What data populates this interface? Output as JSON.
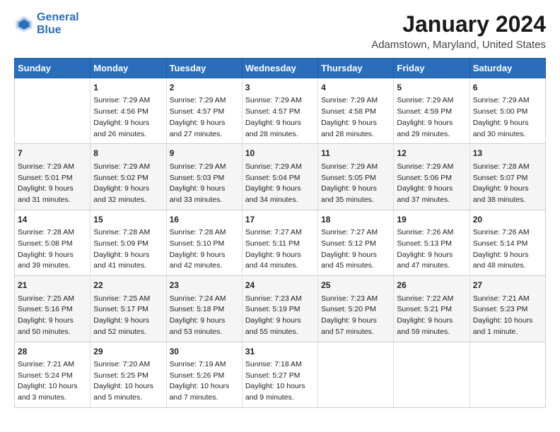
{
  "header": {
    "logo_line1": "General",
    "logo_line2": "Blue",
    "month": "January 2024",
    "location": "Adamstown, Maryland, United States"
  },
  "days_of_week": [
    "Sunday",
    "Monday",
    "Tuesday",
    "Wednesday",
    "Thursday",
    "Friday",
    "Saturday"
  ],
  "weeks": [
    [
      {
        "day": "",
        "sunrise": "",
        "sunset": "",
        "daylight": ""
      },
      {
        "day": "1",
        "sunrise": "Sunrise: 7:29 AM",
        "sunset": "Sunset: 4:56 PM",
        "daylight": "Daylight: 9 hours and 26 minutes."
      },
      {
        "day": "2",
        "sunrise": "Sunrise: 7:29 AM",
        "sunset": "Sunset: 4:57 PM",
        "daylight": "Daylight: 9 hours and 27 minutes."
      },
      {
        "day": "3",
        "sunrise": "Sunrise: 7:29 AM",
        "sunset": "Sunset: 4:57 PM",
        "daylight": "Daylight: 9 hours and 28 minutes."
      },
      {
        "day": "4",
        "sunrise": "Sunrise: 7:29 AM",
        "sunset": "Sunset: 4:58 PM",
        "daylight": "Daylight: 9 hours and 28 minutes."
      },
      {
        "day": "5",
        "sunrise": "Sunrise: 7:29 AM",
        "sunset": "Sunset: 4:59 PM",
        "daylight": "Daylight: 9 hours and 29 minutes."
      },
      {
        "day": "6",
        "sunrise": "Sunrise: 7:29 AM",
        "sunset": "Sunset: 5:00 PM",
        "daylight": "Daylight: 9 hours and 30 minutes."
      }
    ],
    [
      {
        "day": "7",
        "sunrise": "Sunrise: 7:29 AM",
        "sunset": "Sunset: 5:01 PM",
        "daylight": "Daylight: 9 hours and 31 minutes."
      },
      {
        "day": "8",
        "sunrise": "Sunrise: 7:29 AM",
        "sunset": "Sunset: 5:02 PM",
        "daylight": "Daylight: 9 hours and 32 minutes."
      },
      {
        "day": "9",
        "sunrise": "Sunrise: 7:29 AM",
        "sunset": "Sunset: 5:03 PM",
        "daylight": "Daylight: 9 hours and 33 minutes."
      },
      {
        "day": "10",
        "sunrise": "Sunrise: 7:29 AM",
        "sunset": "Sunset: 5:04 PM",
        "daylight": "Daylight: 9 hours and 34 minutes."
      },
      {
        "day": "11",
        "sunrise": "Sunrise: 7:29 AM",
        "sunset": "Sunset: 5:05 PM",
        "daylight": "Daylight: 9 hours and 35 minutes."
      },
      {
        "day": "12",
        "sunrise": "Sunrise: 7:29 AM",
        "sunset": "Sunset: 5:06 PM",
        "daylight": "Daylight: 9 hours and 37 minutes."
      },
      {
        "day": "13",
        "sunrise": "Sunrise: 7:28 AM",
        "sunset": "Sunset: 5:07 PM",
        "daylight": "Daylight: 9 hours and 38 minutes."
      }
    ],
    [
      {
        "day": "14",
        "sunrise": "Sunrise: 7:28 AM",
        "sunset": "Sunset: 5:08 PM",
        "daylight": "Daylight: 9 hours and 39 minutes."
      },
      {
        "day": "15",
        "sunrise": "Sunrise: 7:28 AM",
        "sunset": "Sunset: 5:09 PM",
        "daylight": "Daylight: 9 hours and 41 minutes."
      },
      {
        "day": "16",
        "sunrise": "Sunrise: 7:28 AM",
        "sunset": "Sunset: 5:10 PM",
        "daylight": "Daylight: 9 hours and 42 minutes."
      },
      {
        "day": "17",
        "sunrise": "Sunrise: 7:27 AM",
        "sunset": "Sunset: 5:11 PM",
        "daylight": "Daylight: 9 hours and 44 minutes."
      },
      {
        "day": "18",
        "sunrise": "Sunrise: 7:27 AM",
        "sunset": "Sunset: 5:12 PM",
        "daylight": "Daylight: 9 hours and 45 minutes."
      },
      {
        "day": "19",
        "sunrise": "Sunrise: 7:26 AM",
        "sunset": "Sunset: 5:13 PM",
        "daylight": "Daylight: 9 hours and 47 minutes."
      },
      {
        "day": "20",
        "sunrise": "Sunrise: 7:26 AM",
        "sunset": "Sunset: 5:14 PM",
        "daylight": "Daylight: 9 hours and 48 minutes."
      }
    ],
    [
      {
        "day": "21",
        "sunrise": "Sunrise: 7:25 AM",
        "sunset": "Sunset: 5:16 PM",
        "daylight": "Daylight: 9 hours and 50 minutes."
      },
      {
        "day": "22",
        "sunrise": "Sunrise: 7:25 AM",
        "sunset": "Sunset: 5:17 PM",
        "daylight": "Daylight: 9 hours and 52 minutes."
      },
      {
        "day": "23",
        "sunrise": "Sunrise: 7:24 AM",
        "sunset": "Sunset: 5:18 PM",
        "daylight": "Daylight: 9 hours and 53 minutes."
      },
      {
        "day": "24",
        "sunrise": "Sunrise: 7:23 AM",
        "sunset": "Sunset: 5:19 PM",
        "daylight": "Daylight: 9 hours and 55 minutes."
      },
      {
        "day": "25",
        "sunrise": "Sunrise: 7:23 AM",
        "sunset": "Sunset: 5:20 PM",
        "daylight": "Daylight: 9 hours and 57 minutes."
      },
      {
        "day": "26",
        "sunrise": "Sunrise: 7:22 AM",
        "sunset": "Sunset: 5:21 PM",
        "daylight": "Daylight: 9 hours and 59 minutes."
      },
      {
        "day": "27",
        "sunrise": "Sunrise: 7:21 AM",
        "sunset": "Sunset: 5:23 PM",
        "daylight": "Daylight: 10 hours and 1 minute."
      }
    ],
    [
      {
        "day": "28",
        "sunrise": "Sunrise: 7:21 AM",
        "sunset": "Sunset: 5:24 PM",
        "daylight": "Daylight: 10 hours and 3 minutes."
      },
      {
        "day": "29",
        "sunrise": "Sunrise: 7:20 AM",
        "sunset": "Sunset: 5:25 PM",
        "daylight": "Daylight: 10 hours and 5 minutes."
      },
      {
        "day": "30",
        "sunrise": "Sunrise: 7:19 AM",
        "sunset": "Sunset: 5:26 PM",
        "daylight": "Daylight: 10 hours and 7 minutes."
      },
      {
        "day": "31",
        "sunrise": "Sunrise: 7:18 AM",
        "sunset": "Sunset: 5:27 PM",
        "daylight": "Daylight: 10 hours and 9 minutes."
      },
      {
        "day": "",
        "sunrise": "",
        "sunset": "",
        "daylight": ""
      },
      {
        "day": "",
        "sunrise": "",
        "sunset": "",
        "daylight": ""
      },
      {
        "day": "",
        "sunrise": "",
        "sunset": "",
        "daylight": ""
      }
    ]
  ]
}
